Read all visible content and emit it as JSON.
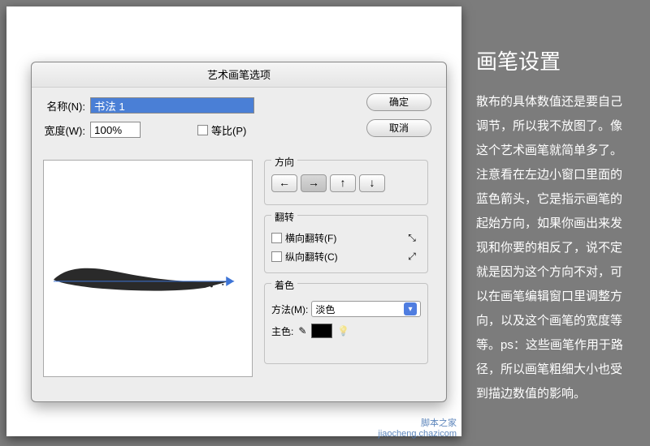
{
  "dialog": {
    "title": "艺术画笔选项",
    "name_label": "名称(N):",
    "name_value": "书法 1",
    "width_label": "宽度(W):",
    "width_value": "100%",
    "equal_ratio_label": "等比(P)",
    "ok": "确定",
    "cancel": "取消"
  },
  "direction": {
    "legend": "方向",
    "arrows": {
      "left": "←",
      "right": "→",
      "up": "↑",
      "down": "↓"
    },
    "active": "right"
  },
  "flip": {
    "legend": "翻转",
    "horiz": "横向翻转(F)",
    "vert": "纵向翻转(C)",
    "horiz_icon": "⤡",
    "vert_icon": "⤢"
  },
  "coloring": {
    "legend": "着色",
    "method_label": "方法(M):",
    "method_value": "淡色",
    "main_color_label": "主色:",
    "eyedropper": "✎",
    "bulb": "💡"
  },
  "article": {
    "title": "画笔设置",
    "body": "散布的具体数值还是要自己调节，所以我不放图了。像这个艺术画笔就简单多了。注意看在左边小窗口里面的蓝色箭头，它是指示画笔的起始方向，如果你画出来发现和你要的相反了，说不定就是因为这个方向不对，可以在画笔编辑窗口里调整方向，以及这个画笔的宽度等等。ps：这些画笔作用于路径，所以画笔粗细大小也受到描边数值的影响。"
  },
  "watermark": {
    "line1": "脚本之家",
    "line2": "jiaocheng.chazicom"
  }
}
